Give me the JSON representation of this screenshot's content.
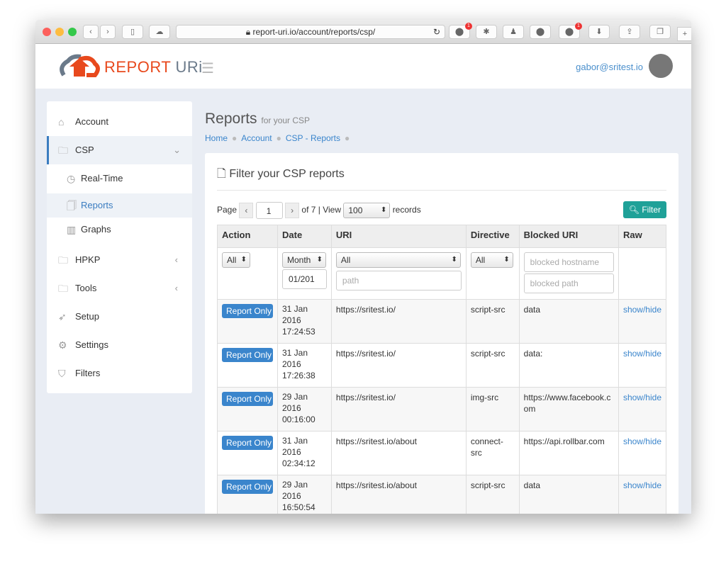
{
  "browser": {
    "url": "report-uri.io/account/reports/csp/"
  },
  "header": {
    "logo": "REPORT URi",
    "logo_a": "REPORT ",
    "logo_b": "URi",
    "user": "gabor@sritest.io"
  },
  "sidebar": {
    "items": [
      {
        "label": "Account",
        "icon": "home-icon"
      },
      {
        "label": "CSP",
        "icon": "folder-icon"
      },
      {
        "label": "Real-Time",
        "icon": "clock-icon"
      },
      {
        "label": "Reports",
        "icon": "document-icon"
      },
      {
        "label": "Graphs",
        "icon": "bar-chart-icon"
      },
      {
        "label": "HPKP",
        "icon": "folder-icon"
      },
      {
        "label": "Tools",
        "icon": "folder-icon"
      },
      {
        "label": "Setup",
        "icon": "rocket-icon"
      },
      {
        "label": "Settings",
        "icon": "gear-icon"
      },
      {
        "label": "Filters",
        "icon": "shield-icon"
      }
    ]
  },
  "page": {
    "title": "Reports",
    "subtitle": "for your CSP",
    "breadcrumb": [
      "Home",
      "Account",
      "CSP - Reports"
    ]
  },
  "card": {
    "title": "Filter your CSP reports",
    "page_label": "Page",
    "page_value": "1",
    "of_label": "of 7 | View",
    "view_value": "100",
    "records_label": "records",
    "filter_button": "Filter"
  },
  "table": {
    "headers": [
      "Action",
      "Date",
      "URI",
      "Directive",
      "Blocked URI",
      "Raw"
    ],
    "filters": {
      "action": "All",
      "date": "Month",
      "date_value": "01/201",
      "uri": "All",
      "path_placeholder": "path",
      "directive": "All",
      "blocked_hostname_placeholder": "blocked hostname",
      "blocked_path_placeholder": "blocked path"
    },
    "rows": [
      {
        "action": "Report Only",
        "date": "31 Jan",
        "year": "2016",
        "time": "17:24:53",
        "uri": "https://sritest.io/",
        "directive": "script-src",
        "blocked": "data",
        "raw": "show/hide"
      },
      {
        "action": "Report Only",
        "date": "31 Jan",
        "year": "2016",
        "time": "17:26:38",
        "uri": "https://sritest.io/",
        "directive": "script-src",
        "blocked": "data:",
        "raw": "show/hide"
      },
      {
        "action": "Report Only",
        "date": "29 Jan",
        "year": "2016",
        "time": "00:16:00",
        "uri": "https://sritest.io/",
        "directive": "img-src",
        "blocked": "https://www.facebook.com",
        "raw": "show/hide"
      },
      {
        "action": "Report Only",
        "date": "31 Jan",
        "year": "2016",
        "time": "02:34:12",
        "uri": "https://sritest.io/about",
        "directive": "connect-src",
        "blocked": "https://api.rollbar.com",
        "raw": "show/hide"
      },
      {
        "action": "Report Only",
        "date": "29 Jan",
        "year": "2016",
        "time": "16:50:54",
        "uri": "https://sritest.io/about",
        "directive": "script-src",
        "blocked": "data",
        "raw": "show/hide"
      }
    ]
  }
}
